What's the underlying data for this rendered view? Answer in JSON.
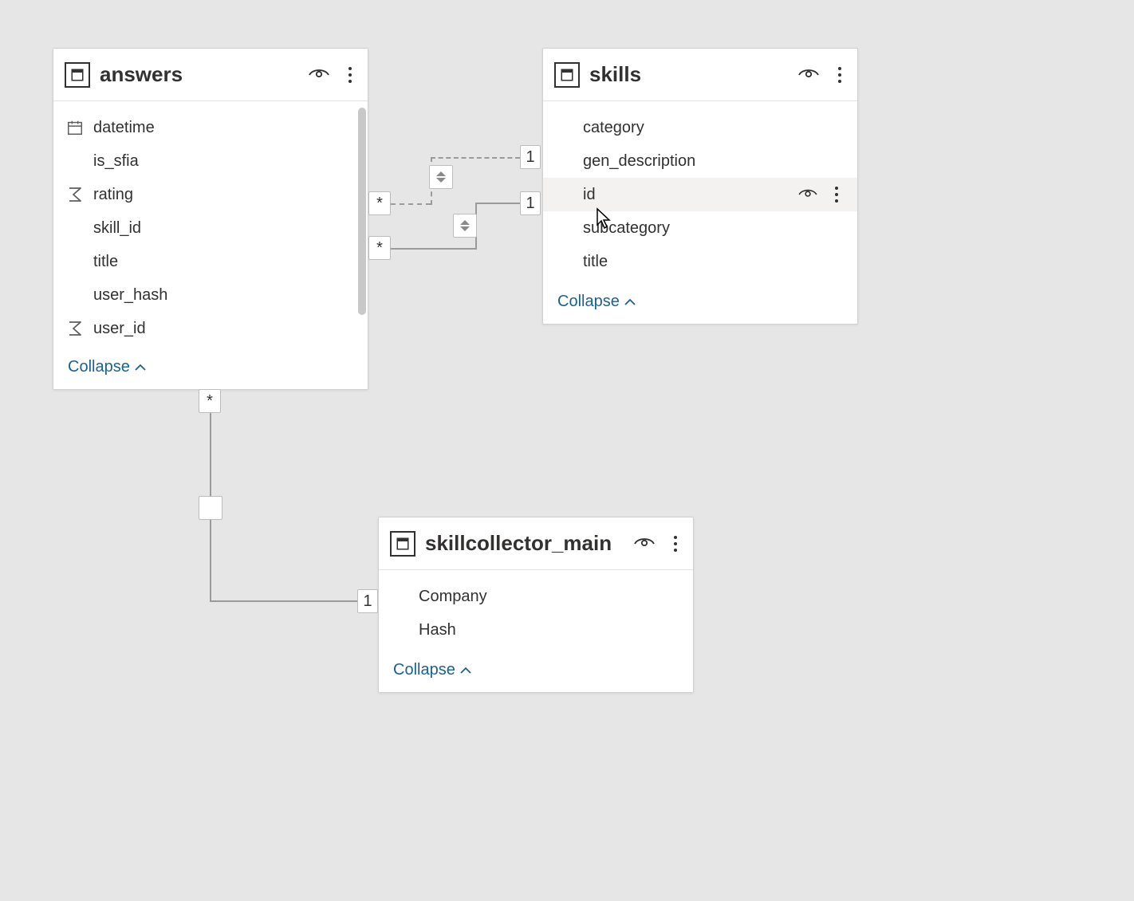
{
  "tables": {
    "answers": {
      "title": "answers",
      "collapse_label": "Collapse",
      "fields": [
        {
          "name": "datetime",
          "icon": "calendar"
        },
        {
          "name": "is_sfia",
          "icon": ""
        },
        {
          "name": "rating",
          "icon": "sum"
        },
        {
          "name": "skill_id",
          "icon": ""
        },
        {
          "name": "title",
          "icon": ""
        },
        {
          "name": "user_hash",
          "icon": ""
        },
        {
          "name": "user_id",
          "icon": "sum"
        }
      ]
    },
    "skills": {
      "title": "skills",
      "collapse_label": "Collapse",
      "fields": [
        {
          "name": "category",
          "icon": ""
        },
        {
          "name": "gen_description",
          "icon": ""
        },
        {
          "name": "id",
          "icon": "",
          "hover": true
        },
        {
          "name": "subcategory",
          "icon": ""
        },
        {
          "name": "title",
          "icon": ""
        }
      ]
    },
    "skillcollector_main": {
      "title": "skillcollector_main",
      "collapse_label": "Collapse",
      "fields": [
        {
          "name": "Company",
          "icon": ""
        },
        {
          "name": "Hash",
          "icon": ""
        }
      ]
    }
  },
  "relationships": [
    {
      "from": "answers.skill_id",
      "to": "skills.id",
      "from_card": "*",
      "to_card": "1",
      "style": "dashed"
    },
    {
      "from": "answers.skill_id",
      "to": "skills.id",
      "from_card": "*",
      "to_card": "1",
      "style": "solid"
    },
    {
      "from": "answers.user_hash",
      "to": "skillcollector_main.Hash",
      "from_card": "*",
      "to_card": "1",
      "style": "solid"
    }
  ],
  "labels": {
    "star": "*",
    "one": "1"
  }
}
